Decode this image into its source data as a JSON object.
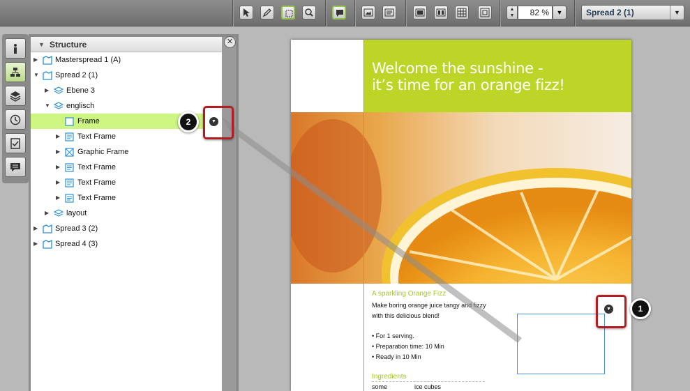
{
  "toolbar": {
    "tools": [
      "select-tool",
      "pen-tool",
      "frame-tool",
      "zoom-tool",
      "comment-tool",
      "image-view",
      "text-view",
      "single-page-view",
      "facing-pages-view",
      "grid-view",
      "fit-view"
    ],
    "zoom_value": "82 %",
    "spread_selector": "Spread 2 (1)"
  },
  "rail": {
    "icons": [
      "info-icon",
      "structure-icon",
      "layers-icon",
      "history-icon",
      "checklist-icon",
      "comments-icon"
    ],
    "active": "structure-icon"
  },
  "structure": {
    "title": "Structure",
    "rows": [
      {
        "label": "Masterspread 1 (A)",
        "level": 0,
        "twisty": "▶",
        "icon": "spread"
      },
      {
        "label": "Spread 2 (1)",
        "level": 0,
        "twisty": "▼",
        "icon": "spread"
      },
      {
        "label": "Ebene 3",
        "level": 1,
        "twisty": "▶",
        "icon": "layer"
      },
      {
        "label": "englisch",
        "level": 1,
        "twisty": "▼",
        "icon": "layer"
      },
      {
        "label": "Frame",
        "level": 2,
        "twisty": "",
        "icon": "frame",
        "selected": true
      },
      {
        "label": "Text Frame",
        "level": 2,
        "twisty": "▶",
        "icon": "text"
      },
      {
        "label": "Graphic Frame",
        "level": 2,
        "twisty": "▶",
        "icon": "graphic"
      },
      {
        "label": "Text Frame",
        "level": 2,
        "twisty": "▶",
        "icon": "text"
      },
      {
        "label": "Text Frame",
        "level": 2,
        "twisty": "▶",
        "icon": "text"
      },
      {
        "label": "Text Frame",
        "level": 2,
        "twisty": "▶",
        "icon": "text"
      },
      {
        "label": "layout",
        "level": 1,
        "twisty": "▶",
        "icon": "layer"
      },
      {
        "label": "Spread 3 (2)",
        "level": 0,
        "twisty": "▶",
        "icon": "spread"
      },
      {
        "label": "Spread 4 (3)",
        "level": 0,
        "twisty": "▶",
        "icon": "spread"
      }
    ]
  },
  "callouts": {
    "one": "1",
    "two": "2"
  },
  "document": {
    "headline_line1": "Welcome the sunshine -",
    "headline_line2": "it’s time for an orange fizz!",
    "subhead": "A sparkling Orange Fizz",
    "intro_line1": "Make boring orange juice tangy and fizzy",
    "intro_line2": "with this delicious blend!",
    "bullet1": "• For 1 serving.",
    "bullet2": "• Preparation time: 10 Min",
    "bullet3": "• Ready in 10 Min",
    "ingredients_heading": "Ingredients",
    "ingredient_qty": "some",
    "ingredient_item": "ice cubes"
  },
  "colors": {
    "accent_green": "#bdd526",
    "selection": "#cdf582",
    "callout_red": "#b01e23"
  }
}
